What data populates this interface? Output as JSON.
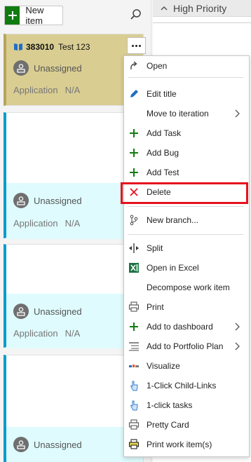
{
  "toolbar": {
    "new_item_label": "New item"
  },
  "right_column": {
    "header": "High Priority"
  },
  "cards": [
    {
      "id": "383010",
      "title": "Test 123",
      "assignee": "Unassigned",
      "field_name": "Application",
      "field_value": "N/A"
    },
    {
      "assignee": "Unassigned",
      "field_name": "Application",
      "field_value": "N/A"
    },
    {
      "assignee": "Unassigned",
      "field_name": "Application",
      "field_value": "N/A"
    },
    {
      "assignee": "Unassigned"
    }
  ],
  "menu": {
    "items": [
      {
        "label": "Open",
        "icon": "open-arrow-icon"
      },
      {
        "label": "Edit title",
        "icon": "pencil-icon"
      },
      {
        "label": "Move to iteration",
        "icon": "",
        "submenu": true
      },
      {
        "label": "Add Task",
        "icon": "plus-icon"
      },
      {
        "label": "Add Bug",
        "icon": "plus-icon"
      },
      {
        "label": "Add Test",
        "icon": "plus-icon"
      },
      {
        "label": "Delete",
        "icon": "x-icon"
      },
      {
        "label": "New branch...",
        "icon": "branch-icon"
      },
      {
        "label": "Split",
        "icon": "split-icon"
      },
      {
        "label": "Open in Excel",
        "icon": "excel-icon"
      },
      {
        "label": "Decompose work item",
        "icon": ""
      },
      {
        "label": "Print",
        "icon": "printer-icon"
      },
      {
        "label": "Add to dashboard",
        "icon": "plus-icon",
        "submenu": true
      },
      {
        "label": "Add to Portfolio Plan",
        "icon": "list-icon",
        "submenu": true
      },
      {
        "label": "Visualize",
        "icon": "visualize-icon"
      },
      {
        "label": "1-Click Child-Links",
        "icon": "pointer-hand-icon"
      },
      {
        "label": "1-click tasks",
        "icon": "pointer-hand-icon"
      },
      {
        "label": "Pretty Card",
        "icon": "printer-icon"
      },
      {
        "label": "Print work item(s)",
        "icon": "printer-color-icon"
      }
    ]
  },
  "colors": {
    "accent_green": "#107c10",
    "feature_card": "#d9cd92",
    "pbi_stripe": "#009ccc",
    "pbi_band": "#dffbfd",
    "delete_red": "#e81123",
    "highlight_box": "#e5131f"
  }
}
